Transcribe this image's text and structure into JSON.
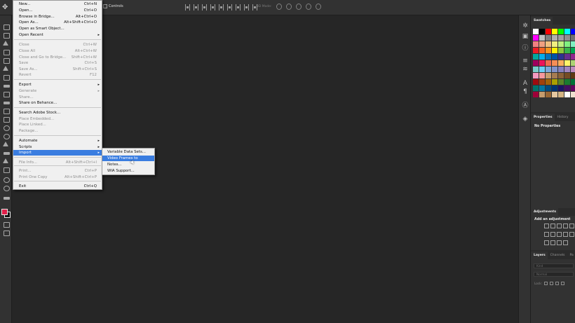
{
  "options_bar": {
    "show_transform_label": "Controls",
    "mode_3d_label": "3D Mode:"
  },
  "file_menu": {
    "items": [
      {
        "label": "New...",
        "shortcut": "Ctrl+N",
        "disabled": false
      },
      {
        "label": "Open...",
        "shortcut": "Ctrl+O",
        "disabled": false
      },
      {
        "label": "Browse in Bridge...",
        "shortcut": "Alt+Ctrl+O",
        "disabled": false
      },
      {
        "label": "Open As...",
        "shortcut": "Alt+Shift+Ctrl+O",
        "disabled": false
      },
      {
        "label": "Open as Smart Object...",
        "shortcut": "",
        "disabled": false
      },
      {
        "label": "Open Recent",
        "shortcut": "",
        "submenu": true,
        "disabled": false
      },
      {
        "label": "Close",
        "shortcut": "Ctrl+W",
        "disabled": true
      },
      {
        "label": "Close All",
        "shortcut": "Alt+Ctrl+W",
        "disabled": true
      },
      {
        "label": "Close and Go to Bridge...",
        "shortcut": "Shift+Ctrl+W",
        "disabled": true
      },
      {
        "label": "Save",
        "shortcut": "Ctrl+S",
        "disabled": true
      },
      {
        "label": "Save As...",
        "shortcut": "Shift+Ctrl+S",
        "disabled": true
      },
      {
        "label": "Revert",
        "shortcut": "F12",
        "disabled": true
      },
      {
        "label": "Export",
        "shortcut": "",
        "submenu": true,
        "disabled": false
      },
      {
        "label": "Generate",
        "shortcut": "",
        "submenu": true,
        "disabled": true
      },
      {
        "label": "Share...",
        "shortcut": "",
        "disabled": true
      },
      {
        "label": "Share on Behance...",
        "shortcut": "",
        "disabled": false
      },
      {
        "label": "Search Adobe Stock...",
        "shortcut": "",
        "disabled": false
      },
      {
        "label": "Place Embedded...",
        "shortcut": "",
        "disabled": true
      },
      {
        "label": "Place Linked...",
        "shortcut": "",
        "disabled": true
      },
      {
        "label": "Package...",
        "shortcut": "",
        "disabled": true
      },
      {
        "label": "Automate",
        "shortcut": "",
        "submenu": true,
        "disabled": false
      },
      {
        "label": "Scripts",
        "shortcut": "",
        "submenu": true,
        "disabled": false
      },
      {
        "label": "Import",
        "shortcut": "",
        "submenu": true,
        "disabled": false,
        "highlighted": true
      },
      {
        "label": "File Info...",
        "shortcut": "Alt+Shift+Ctrl+I",
        "disabled": true
      },
      {
        "label": "Print...",
        "shortcut": "Ctrl+P",
        "disabled": true
      },
      {
        "label": "Print One Copy",
        "shortcut": "Alt+Shift+Ctrl+P",
        "disabled": true
      },
      {
        "label": "Exit",
        "shortcut": "Ctrl+Q",
        "disabled": false
      }
    ]
  },
  "import_submenu": {
    "items": [
      {
        "label": "Variable Data Sets...",
        "highlighted": false
      },
      {
        "label": "Video Frames to Layers...",
        "highlighted": true
      },
      {
        "label": "Notes...",
        "highlighted": false
      },
      {
        "label": "WIA Support...",
        "highlighted": false
      }
    ]
  },
  "panels": {
    "swatches": {
      "tab": "Swatches"
    },
    "properties": {
      "tabs": [
        "Properties",
        "History"
      ],
      "empty_text": "No Properties"
    },
    "adjustments": {
      "tab": "Adjustments",
      "label": "Add an adjustment"
    },
    "layers": {
      "tabs": [
        "Layers",
        "Channels",
        "Pa"
      ],
      "filter_placeholder": "Kind",
      "blend_mode": "Normal",
      "lock_label": "Lock:"
    }
  },
  "colors": {
    "foreground": "#e0204a",
    "background": "#111111",
    "menu_highlight": "#3a7de0"
  },
  "swatches": [
    "#ffffff",
    "#000000",
    "#ff0000",
    "#ffff00",
    "#00ff00",
    "#00ffff",
    "#0000ff",
    "#ff00ff",
    "#c0c0c0",
    "#808080",
    "#b0b0b0",
    "#a0a0a0",
    "#909090",
    "#707070",
    "#f08080",
    "#f0a080",
    "#f0c080",
    "#f0f080",
    "#c0f080",
    "#80f080",
    "#80f0c0",
    "#ed1c24",
    "#f26522",
    "#f7941d",
    "#fff200",
    "#8dc63f",
    "#39b54a",
    "#00a651",
    "#00a99d",
    "#00aeef",
    "#0072bc",
    "#0054a6",
    "#2e3192",
    "#662d91",
    "#92278f",
    "#9e005d",
    "#ed145b",
    "#f26c4f",
    "#f68e56",
    "#fbaf5d",
    "#fff568",
    "#acd373",
    "#7accc8",
    "#6dcff6",
    "#7da7d9",
    "#8393ca",
    "#8781bd",
    "#a186be",
    "#bd8cbf",
    "#f49ac1",
    "#f6989d",
    "#c69c6d",
    "#a67c52",
    "#8c6239",
    "#754c24",
    "#603913",
    "#9e0b0f",
    "#a0410d",
    "#a36209",
    "#aba000",
    "#598527",
    "#1a7b30",
    "#007236",
    "#00746b",
    "#0076a3",
    "#004b80",
    "#003471",
    "#1b1464",
    "#440e62",
    "#630460",
    "#9e0039",
    "#c69c6d",
    "#996633",
    "#e6c8a0",
    "#d4b483",
    "#ffffff",
    "#f0e0d0"
  ]
}
